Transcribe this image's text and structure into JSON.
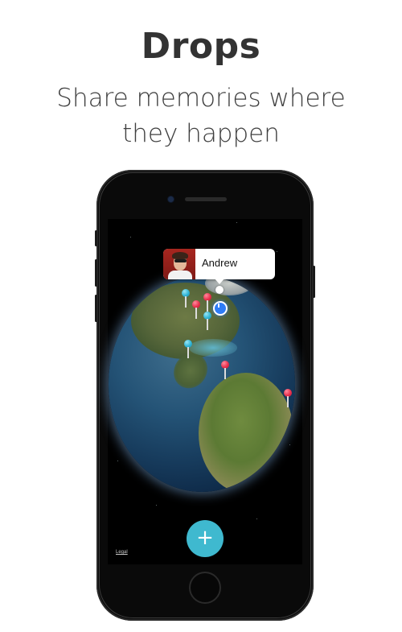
{
  "header": {
    "title": "Drops",
    "subtitle_line1": "Share memories where",
    "subtitle_line2": "they happen"
  },
  "map": {
    "callout": {
      "name": "Andrew",
      "avatar": "user-avatar"
    },
    "pins": [
      {
        "color": "blue",
        "icon": "map-pin-icon"
      },
      {
        "color": "red",
        "icon": "map-pin-icon"
      },
      {
        "color": "red",
        "icon": "map-pin-icon"
      },
      {
        "color": "blue",
        "icon": "map-pin-icon"
      },
      {
        "color": "blue",
        "icon": "map-pin-icon"
      },
      {
        "color": "red",
        "icon": "map-pin-icon"
      },
      {
        "color": "red",
        "icon": "map-pin-icon"
      }
    ],
    "legal_label": "Legal",
    "add_button_label": "+"
  },
  "colors": {
    "accent": "#3fb9cf",
    "pin_red": "#e8304d",
    "pin_blue": "#2fb4d6",
    "location": "#2f7cf6"
  }
}
